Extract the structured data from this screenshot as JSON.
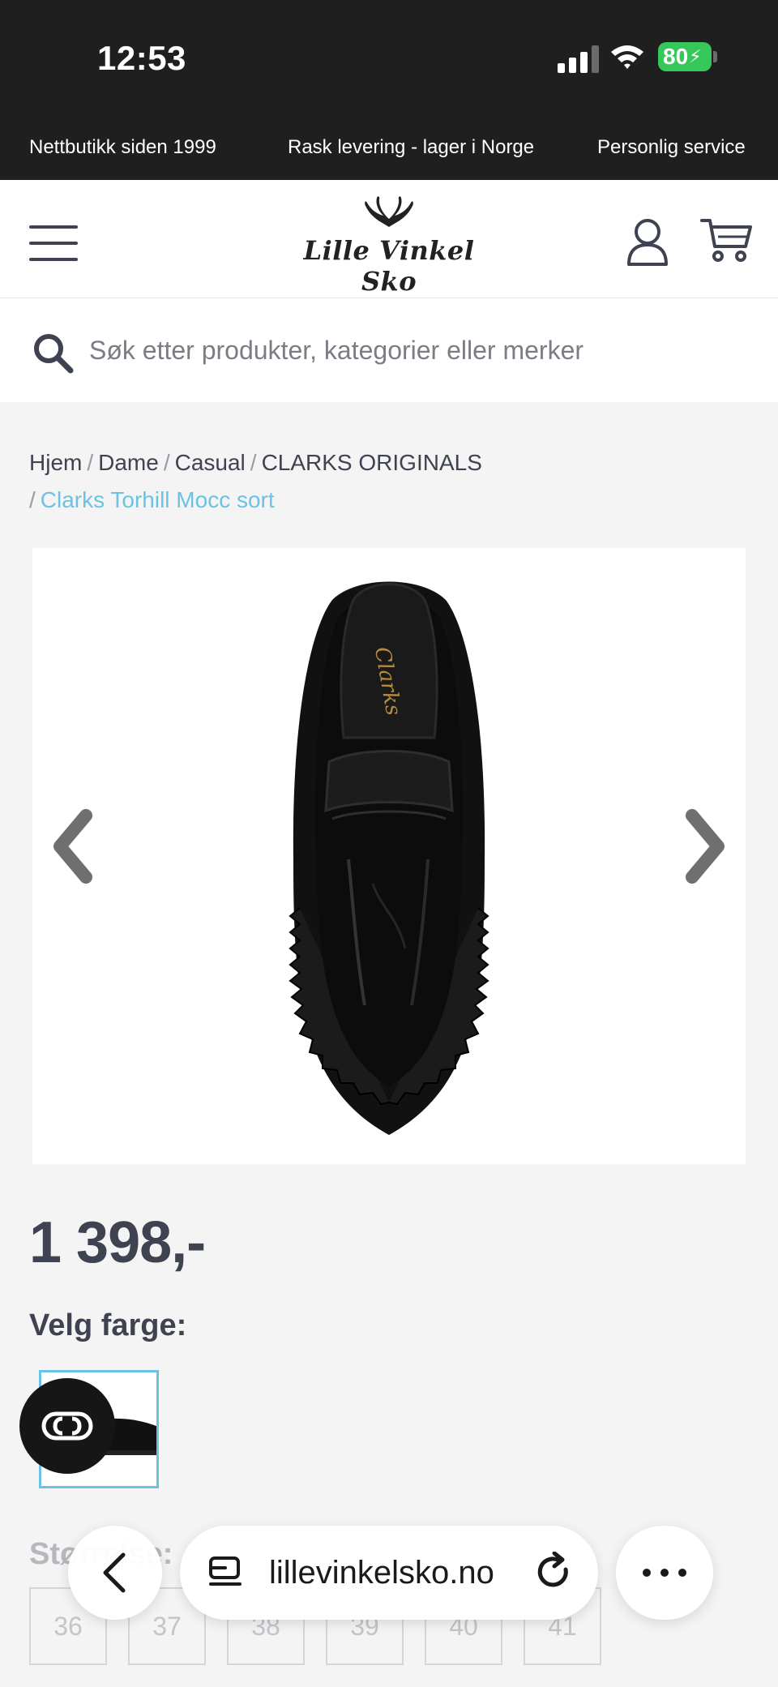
{
  "status_bar": {
    "time": "12:53",
    "battery": "80"
  },
  "promo": {
    "item1": "Nettbutikk siden 1999",
    "item2": "Rask levering - lager i Norge",
    "item3": "Personlig service"
  },
  "header": {
    "logo_text": "Lille Vinkel Sko"
  },
  "search": {
    "placeholder": "Søk etter produkter, kategorier eller merker",
    "value": ""
  },
  "breadcrumb": {
    "items": [
      "Hjem",
      "Dame",
      "Casual",
      "CLARKS ORIGINALS"
    ],
    "current": "Clarks Torhill Mocc sort",
    "separator": "/"
  },
  "product": {
    "price": "1 398,-",
    "color_label": "Velg farge:",
    "size_label": "Størrelse:",
    "sizes": [
      "36",
      "37",
      "38",
      "39",
      "40",
      "41"
    ]
  },
  "browser": {
    "url": "lillevinkelsko.no"
  },
  "colors": {
    "dark": "#1f1f1f",
    "accent": "#6bc3e3",
    "text": "#3f4250",
    "battery": "#35c759"
  },
  "icons": [
    "menu-icon",
    "user-icon",
    "cart-icon",
    "search-icon",
    "chevron-left-icon",
    "chevron-right-icon",
    "chat-icon",
    "back-icon",
    "tabs-icon",
    "reload-icon",
    "more-icon"
  ]
}
